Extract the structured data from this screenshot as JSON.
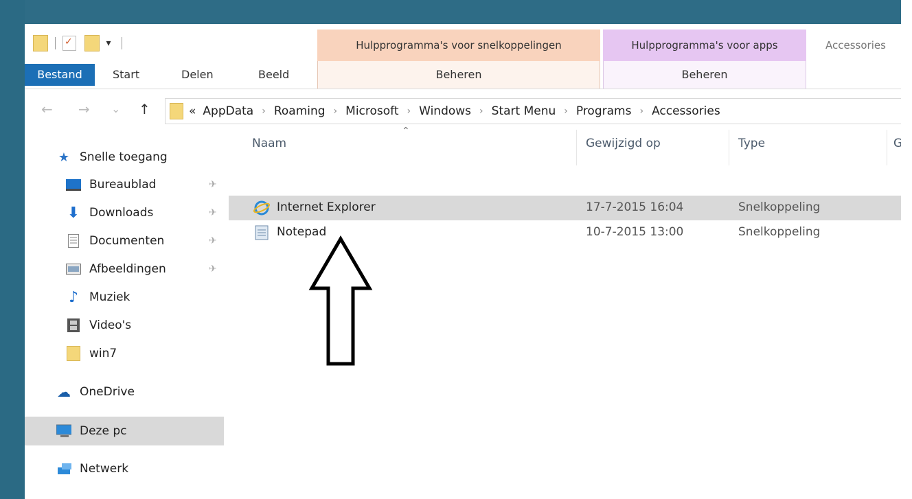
{
  "qat": {
    "dropdown": "▾"
  },
  "contextual_tabs": {
    "shortcut_tools": "Hulpprogramma's voor snelkoppelingen",
    "app_tools": "Hulpprogramma's voor apps",
    "partial": "Accessories"
  },
  "ribbon_tabs": [
    "Bestand",
    "Start",
    "Delen",
    "Beeld"
  ],
  "contextual_manage": [
    "Beheren",
    "Beheren"
  ],
  "nav": {
    "back": "←",
    "forward": "→",
    "recent": "⌄",
    "up": "↑"
  },
  "address": {
    "overflow": "«",
    "crumbs": [
      "AppData",
      "Roaming",
      "Microsoft",
      "Windows",
      "Start Menu",
      "Programs",
      "Accessories"
    ]
  },
  "sidebar": {
    "quick_access": "Snelle toegang",
    "items": [
      {
        "label": "Bureaublad",
        "icon": "desktop-icon",
        "pinned": true
      },
      {
        "label": "Downloads",
        "icon": "download-icon",
        "pinned": true
      },
      {
        "label": "Documenten",
        "icon": "document-icon",
        "pinned": true
      },
      {
        "label": "Afbeeldingen",
        "icon": "pictures-icon",
        "pinned": true
      },
      {
        "label": "Muziek",
        "icon": "music-icon",
        "pinned": false
      },
      {
        "label": "Video's",
        "icon": "video-icon",
        "pinned": false
      },
      {
        "label": "win7",
        "icon": "folder-icon",
        "pinned": false
      }
    ],
    "onedrive": "OneDrive",
    "this_pc": "Deze pc",
    "network": "Netwerk"
  },
  "columns": {
    "name": "Naam",
    "modified": "Gewijzigd op",
    "type": "Type",
    "partial": "G"
  },
  "files": [
    {
      "name": "Internet Explorer",
      "modified": "17-7-2015 16:04",
      "type": "Snelkoppeling",
      "icon": "internet-explorer-icon",
      "selected": true
    },
    {
      "name": "Notepad",
      "modified": "10-7-2015 13:00",
      "type": "Snelkoppeling",
      "icon": "notepad-icon",
      "selected": false
    }
  ]
}
